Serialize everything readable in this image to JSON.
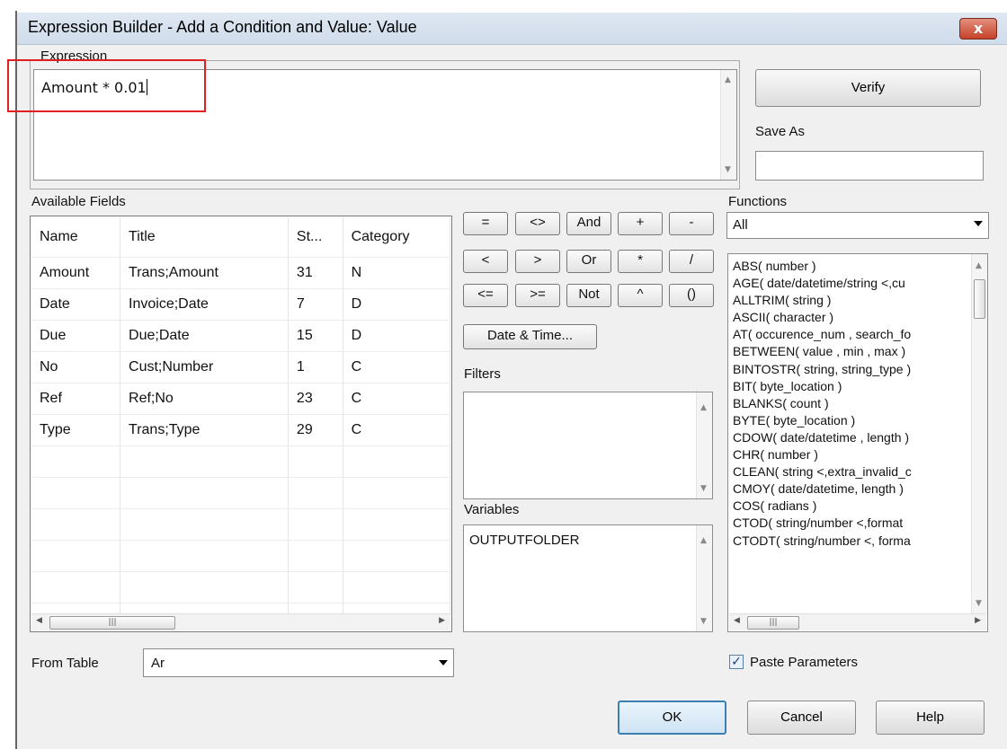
{
  "title": "Expression Builder - Add a Condition and Value: Value",
  "close_label": "x",
  "expression": {
    "label": "Expression",
    "value": "Amount * 0.01"
  },
  "verify_label": "Verify",
  "save_as": {
    "label": "Save As",
    "value": ""
  },
  "available_fields": {
    "label": "Available Fields",
    "columns": [
      "Name",
      "Title",
      "St...",
      "Category"
    ],
    "rows": [
      [
        "Amount",
        "Trans;Amount",
        "31",
        "N"
      ],
      [
        "Date",
        "Invoice;Date",
        "7",
        "D"
      ],
      [
        "Due",
        "Due;Date",
        "15",
        "D"
      ],
      [
        "No",
        "Cust;Number",
        "1",
        "C"
      ],
      [
        "Ref",
        "Ref;No",
        "23",
        "C"
      ],
      [
        "Type",
        "Trans;Type",
        "29",
        "C"
      ]
    ]
  },
  "operators": {
    "row1": [
      "=",
      "<>",
      "And",
      "+",
      "-"
    ],
    "row2": [
      "<",
      ">",
      "Or",
      "*",
      "/"
    ],
    "row3": [
      "<=",
      ">=",
      "Not",
      "^",
      "()"
    ]
  },
  "date_time_label": "Date & Time...",
  "filters_label": "Filters",
  "variables": {
    "label": "Variables",
    "items": [
      "OUTPUTFOLDER"
    ]
  },
  "functions": {
    "label": "Functions",
    "selected": "All",
    "items": [
      "ABS( number )",
      "AGE( date/datetime/string <,cu",
      "ALLTRIM( string )",
      "ASCII( character )",
      "AT( occurence_num , search_fo",
      "BETWEEN( value , min , max )",
      "BINTOSTR( string, string_type )",
      "BIT( byte_location )",
      "BLANKS( count )",
      "BYTE( byte_location )",
      "CDOW( date/datetime , length )",
      "CHR( number )",
      "CLEAN( string <,extra_invalid_c",
      "CMOY( date/datetime, length )",
      "COS( radians )",
      "CTOD( string/number <,format",
      "CTODT( string/number <, forma"
    ]
  },
  "from_table": {
    "label": "From Table",
    "value": "Ar"
  },
  "paste_parameters": {
    "label": "Paste Parameters",
    "checked": true
  },
  "buttons": {
    "ok": "OK",
    "cancel": "Cancel",
    "help": "Help"
  }
}
